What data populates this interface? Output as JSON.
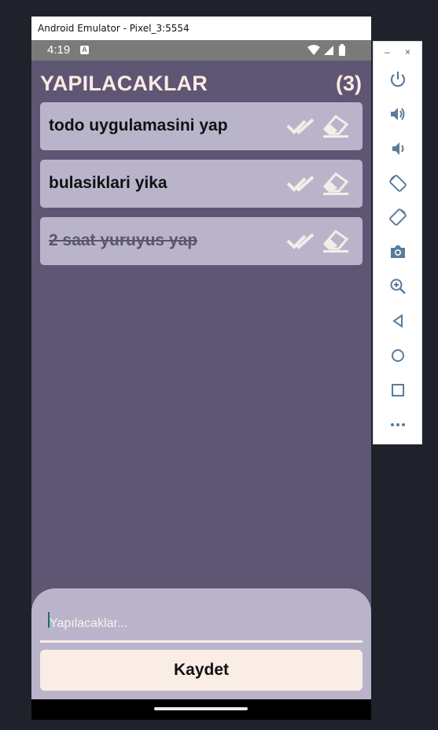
{
  "window": {
    "title": "Android Emulator - Pixel_3:5554"
  },
  "statusbar": {
    "time": "4:19",
    "notif_icon": "A"
  },
  "app": {
    "title": "YAPILACAKLAR",
    "count": "(3)"
  },
  "todos": [
    {
      "text": "todo uygulamasini yap",
      "completed": false
    },
    {
      "text": "bulasiklari yika",
      "completed": false
    },
    {
      "text": "2 saat yuruyus yap",
      "completed": true
    }
  ],
  "input": {
    "placeholder": "Yapılacaklar..."
  },
  "save": {
    "label": "Kaydet"
  },
  "toolbar": {
    "minimize": "–",
    "close": "×",
    "buttons": [
      "power-icon",
      "volume-up-icon",
      "volume-down-icon",
      "rotate-left-icon",
      "rotate-right-icon",
      "camera-icon",
      "zoom-icon",
      "back-icon",
      "home-icon",
      "overview-icon",
      "more-icon"
    ]
  },
  "colors": {
    "screen_bg": "#5e5673",
    "card_bg": "#bab4cb",
    "title": "#fbe9e4",
    "button_bg": "#f9ede5",
    "icon": "#f5ede8"
  }
}
